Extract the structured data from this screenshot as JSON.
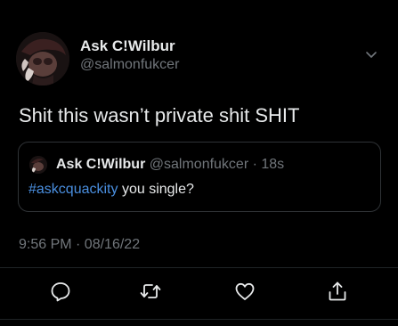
{
  "tweet": {
    "author": {
      "display_name": "Ask C!Wilbur",
      "handle": "@salmonfukcer"
    },
    "text": "Shit this wasn’t private shit SHIT",
    "quoted": {
      "display_name": "Ask C!Wilbur",
      "handle": "@salmonfukcer",
      "separator": " · ",
      "age": "18s",
      "hashtag": "#askcquackity",
      "body_rest": " you single?"
    },
    "timestamp": "9:56 PM · 08/16/22"
  },
  "actions": {
    "icons": [
      "reply-icon",
      "retweet-icon",
      "like-icon",
      "share-icon"
    ]
  },
  "colors": {
    "background": "#000000",
    "primary_text": "#e7e9ea",
    "secondary_text": "#71767b",
    "hashtag": "#4a8fe0",
    "border": "#2f3336"
  }
}
